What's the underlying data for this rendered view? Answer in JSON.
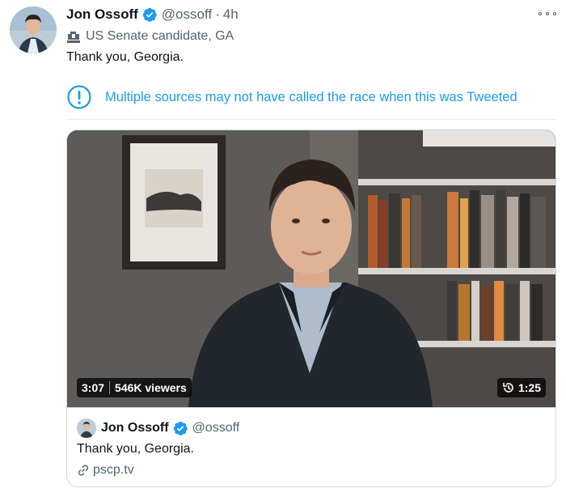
{
  "tweet": {
    "author_name": "Jon Ossoff",
    "handle": "@ossoff",
    "separator": "·",
    "time": "4h",
    "label": "US Senate candidate, GA",
    "text": "Thank you, Georgia.",
    "notice": "Multiple sources may not have called the race when this was Tweeted"
  },
  "video": {
    "elapsed": "3:07",
    "viewers": "546K viewers",
    "replay_duration": "1:25"
  },
  "quoted_card": {
    "author_name": "Jon Ossoff",
    "handle": "@ossoff",
    "text": "Thank you, Georgia.",
    "link": "pscp.tv"
  },
  "icons": {
    "verified": "verified-badge-icon",
    "label": "government-building-icon",
    "notice": "exclamation-circle-icon",
    "more": "more-options-icon",
    "replay": "replay-clock-icon",
    "link": "link-icon"
  },
  "colors": {
    "accent": "#1d9bf0",
    "text": "#0f1419",
    "secondary": "#536471",
    "border": "#cfd9de"
  }
}
